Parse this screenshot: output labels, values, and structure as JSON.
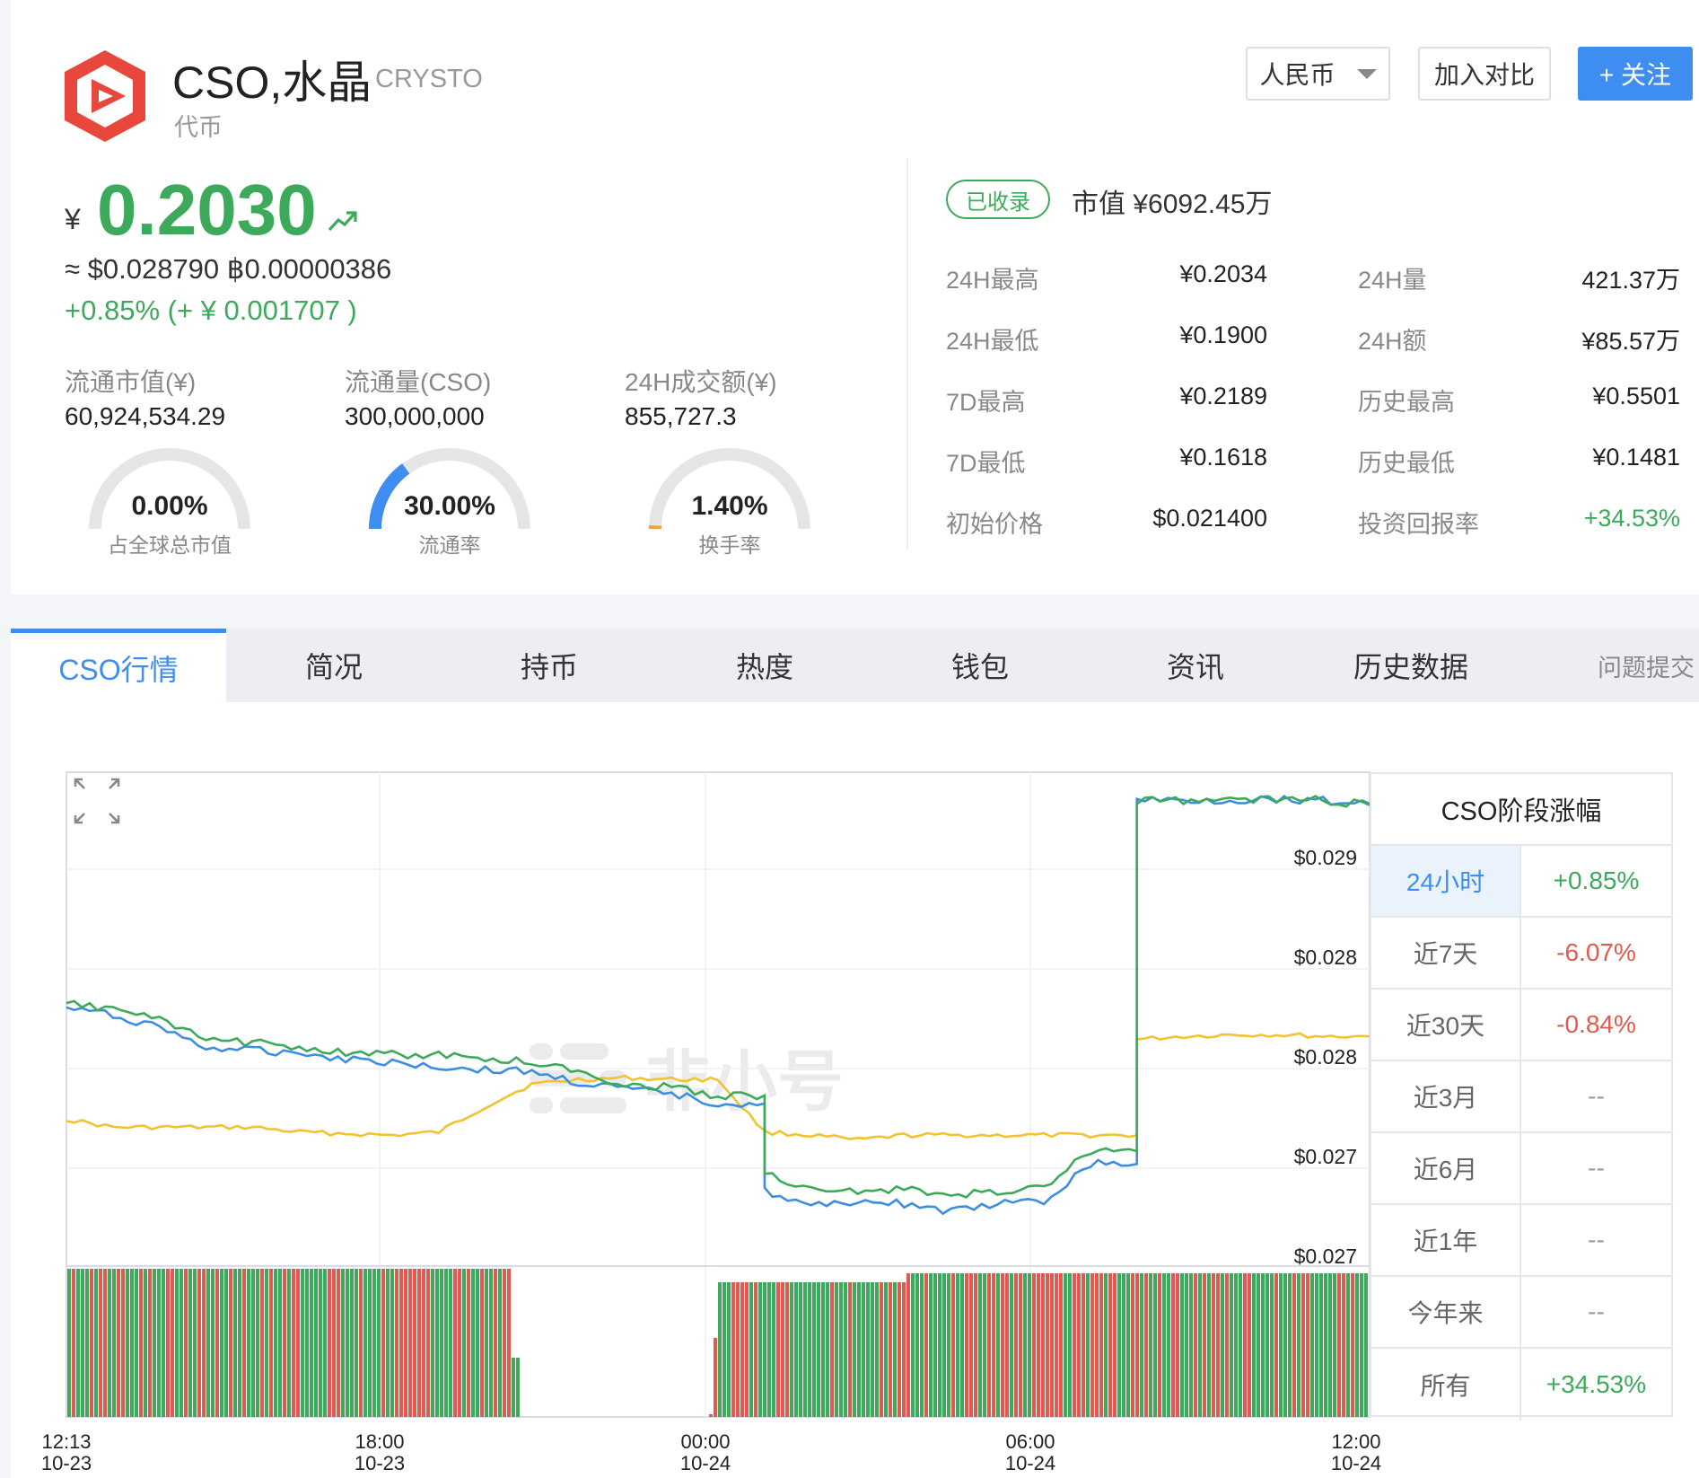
{
  "coin": {
    "name": "CSO,水晶",
    "subtitle": "CRYSTO",
    "type": "代币",
    "logo_color": "#e8473b"
  },
  "header_buttons": {
    "currency": "人民币",
    "compare": "加入对比",
    "follow": "+ 关注"
  },
  "price": {
    "currency_symbol": "¥",
    "value": "0.2030",
    "usd_btc": "≈ $0.028790   ฿0.00000386",
    "change": "+0.85%  (+ ¥ 0.001707 )",
    "trend_icon": "trend-up-icon",
    "color_up": "#3daa5b"
  },
  "stats": [
    {
      "label": "流通市值(¥)",
      "value": "60,924,534.29",
      "gauge_pct": "0.00%",
      "gauge_caption": "占全球总市值",
      "gauge_fraction": 0.0
    },
    {
      "label": "流通量(CSO)",
      "value": "300,000,000",
      "gauge_pct": "30.00%",
      "gauge_caption": "流通率",
      "gauge_fraction": 0.3
    },
    {
      "label": "24H成交额(¥)",
      "value": "855,727.3",
      "gauge_pct": "1.40%",
      "gauge_caption": "换手率",
      "gauge_fraction": 0.014
    }
  ],
  "listing": {
    "badge": "已收录",
    "market_cap": "市值  ¥6092.45万"
  },
  "kv": [
    {
      "l1": "24H最高",
      "v1": "¥0.2034",
      "l2": "24H量",
      "v2": "421.37万"
    },
    {
      "l1": "24H最低",
      "v1": "¥0.1900",
      "l2": "24H额",
      "v2": "¥85.57万"
    },
    {
      "l1": "7D最高",
      "v1": "¥0.2189",
      "l2": "历史最高",
      "v2": "¥0.5501"
    },
    {
      "l1": "7D最低",
      "v1": "¥0.1618",
      "l2": "历史最低",
      "v2": "¥0.1481"
    },
    {
      "l1": "初始价格",
      "v1": "$0.021400",
      "l2": "投资回报率",
      "v2": "+34.53%",
      "v2_up": true
    }
  ],
  "tabs": [
    "CSO行情",
    "简况",
    "持币",
    "热度",
    "钱包",
    "资讯",
    "历史数据",
    "问题提交"
  ],
  "active_tab": 0,
  "stage_table": {
    "title": "CSO阶段涨幅",
    "rows": [
      {
        "period": "24小时",
        "value": "+0.85%",
        "dir": "up",
        "selected": true
      },
      {
        "period": "近7天",
        "value": "-6.07%",
        "dir": "down"
      },
      {
        "period": "近30天",
        "value": "-0.84%",
        "dir": "down"
      },
      {
        "period": "近3月",
        "value": "--",
        "dir": "none"
      },
      {
        "period": "近6月",
        "value": "--",
        "dir": "none"
      },
      {
        "period": "近1年",
        "value": "--",
        "dir": "none"
      },
      {
        "period": "今年来",
        "value": "--",
        "dir": "none"
      },
      {
        "period": "所有",
        "value": "+34.53%",
        "dir": "up"
      }
    ]
  },
  "chart_data": {
    "type": "line",
    "x_ticks": [
      {
        "time": "12:13",
        "date": "10-23"
      },
      {
        "time": "18:00",
        "date": "10-23"
      },
      {
        "time": "00:00",
        "date": "10-24"
      },
      {
        "time": "06:00",
        "date": "10-24"
      },
      {
        "time": "12:00",
        "date": "10-24"
      }
    ],
    "y_ticks": [
      "$0.029",
      "$0.028",
      "$0.028",
      "$0.027",
      "$0.027"
    ],
    "series_colors": {
      "green": "#3daa5b",
      "blue": "#3d8ee0",
      "yellow": "#f2c230"
    },
    "volume_colors": {
      "up": "#3daa5b",
      "down": "#e05a4f"
    },
    "watermark": "非小号",
    "green_values": [
      0.02862,
      0.0286,
      0.02852,
      0.0284,
      0.02838,
      0.02836,
      0.02831,
      0.02831,
      0.0283,
      0.02828,
      0.02826,
      0.0282,
      0.02812,
      0.0281,
      0.02805,
      0.02757,
      0.02745,
      0.02745,
      0.02746,
      0.02742,
      0.02745,
      0.02747,
      0.0277,
      0.0299,
      0.0299,
      0.0299,
      0.02991,
      0.0299,
      0.02987
    ],
    "blue_values": [
      0.0286,
      0.02855,
      0.02848,
      0.02835,
      0.02833,
      0.02832,
      0.02828,
      0.02826,
      0.02823,
      0.02821,
      0.0282,
      0.02813,
      0.02809,
      0.02806,
      0.028,
      0.02745,
      0.02735,
      0.02739,
      0.02737,
      0.02732,
      0.02737,
      0.02738,
      0.02762,
      0.0299,
      0.0299,
      0.0299,
      0.02991,
      0.0299,
      0.02988
    ],
    "yellow_values": [
      0.0279,
      0.02785,
      0.02785,
      0.02785,
      0.02785,
      0.02782,
      0.02781,
      0.0278,
      0.02782,
      0.02798,
      0.02812,
      0.02815,
      0.02816,
      0.02815,
      0.02815,
      0.02782,
      0.0278,
      0.02777,
      0.0278,
      0.0278,
      0.0278,
      0.0278,
      0.0278,
      0.0284,
      0.02842,
      0.02843,
      0.02843,
      0.02842,
      0.02842
    ],
    "y_range": [
      0.02698,
      0.03002
    ]
  }
}
